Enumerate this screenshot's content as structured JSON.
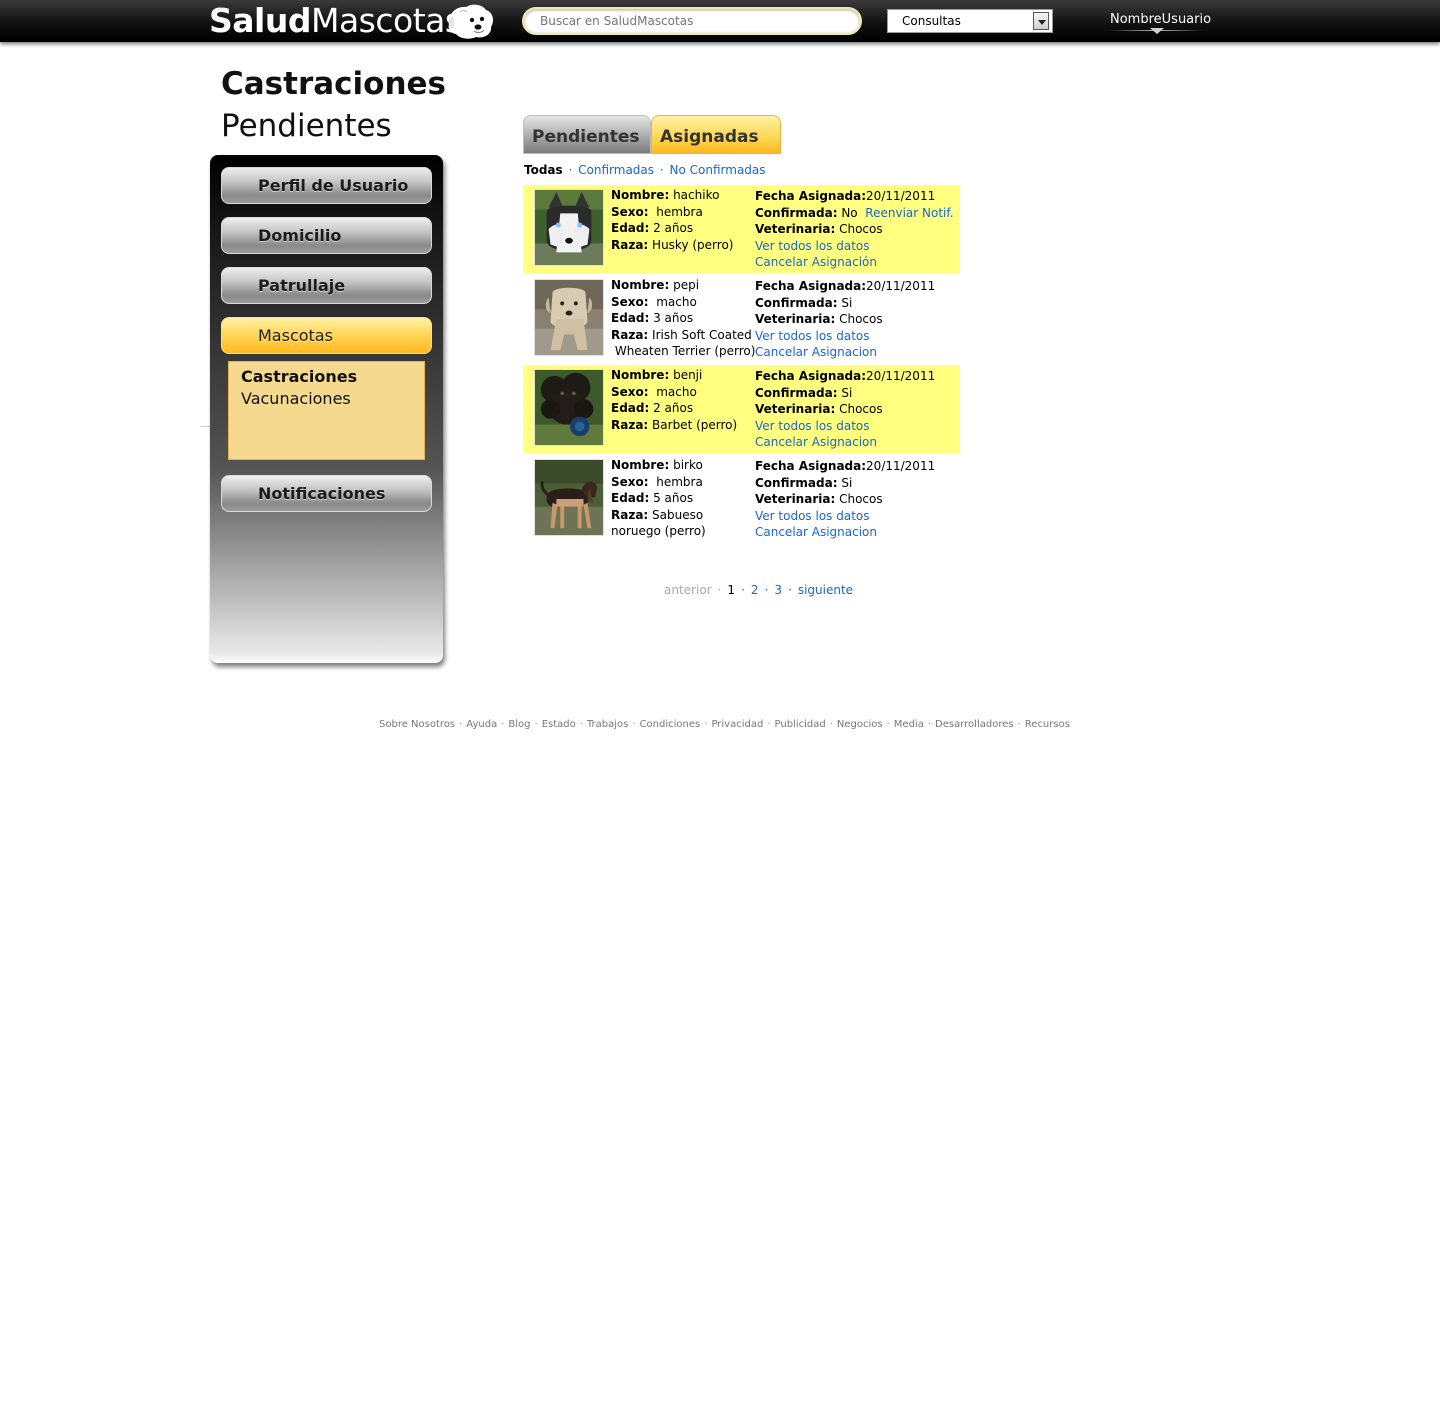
{
  "header": {
    "logo_bold": "Salud",
    "logo_light": "Mascotas",
    "search_placeholder": "Buscar en SaludMascotas",
    "select_value": "Consultas",
    "username": "NombreUsuario"
  },
  "page": {
    "title": "Castraciones",
    "subtitle": "Pendientes"
  },
  "sidebar": {
    "items": [
      {
        "label": "Perfil de Usuario"
      },
      {
        "label": "Domicilio"
      },
      {
        "label": "Patrullaje"
      },
      {
        "label": "Mascotas"
      },
      {
        "label": "Notificaciones"
      }
    ],
    "subitems": [
      {
        "label": "Castraciones"
      },
      {
        "label": "Vacunaciones"
      }
    ]
  },
  "tabs": [
    {
      "label": "Pendientes"
    },
    {
      "label": "Asignadas"
    }
  ],
  "filters": {
    "all": "Todas",
    "confirmed": "Confirmadas",
    "unconfirmed": "No Confirmadas",
    "separator": "·"
  },
  "labels": {
    "name": "Nombre:",
    "sex": "Sexo:",
    "age": "Edad:",
    "breed": "Raza:",
    "date": "Fecha Asignada:",
    "confirmed": "Confirmada:",
    "vet": "Veterinaria:"
  },
  "records": [
    {
      "name": "hachiko",
      "sex": "hembra",
      "age": "2 años",
      "breed_1": "Husky (perro)",
      "breed_2": "",
      "date": "20/11/2011",
      "confirmed": "No",
      "resend": "Reenviar Notif.",
      "vet": "Chocos",
      "view_all": "Ver todos los datos",
      "cancel": "Cancelar Asignación"
    },
    {
      "name": "pepi",
      "sex": "macho",
      "age": "3 años",
      "breed_1": "Irish Soft Coated",
      "breed_2": "Wheaten Terrier (perro)",
      "date": "20/11/2011",
      "confirmed": "Si",
      "resend": "",
      "vet": "Chocos",
      "view_all": "Ver todos los datos",
      "cancel": "Cancelar Asignacion"
    },
    {
      "name": "benji",
      "sex": "macho",
      "age": "2 años",
      "breed_1": "Barbet (perro)",
      "breed_2": "",
      "date": "20/11/2011",
      "confirmed": "Si",
      "resend": "",
      "vet": "Chocos",
      "view_all": "Ver todos los datos",
      "cancel": "Cancelar Asignacion"
    },
    {
      "name": "birko",
      "sex": "hembra",
      "age": "5 años",
      "breed_1": "Sabueso",
      "breed_2": "noruego (perro)",
      "date": "20/11/2011",
      "confirmed": "Si",
      "resend": "",
      "vet": "Chocos",
      "view_all": "Ver todos los datos",
      "cancel": "Cancelar Asignacion"
    }
  ],
  "pagination": {
    "prev": "anterior",
    "pages": [
      "1",
      "2",
      "3"
    ],
    "next": "siguiente",
    "separator": "·"
  },
  "footer": {
    "links": [
      "Sobre Nosotros",
      "Ayuda",
      "Blog",
      "Estado",
      "Trabajos",
      "Condiciones",
      "Privacidad",
      "Publicidad",
      "Negocios",
      "Media",
      "Desarrolladores",
      "Recursos"
    ],
    "separator": "·"
  },
  "colors": {
    "highlight_row": "#ffff80",
    "link": "#1a66cc",
    "accent": "#ffd75c"
  }
}
